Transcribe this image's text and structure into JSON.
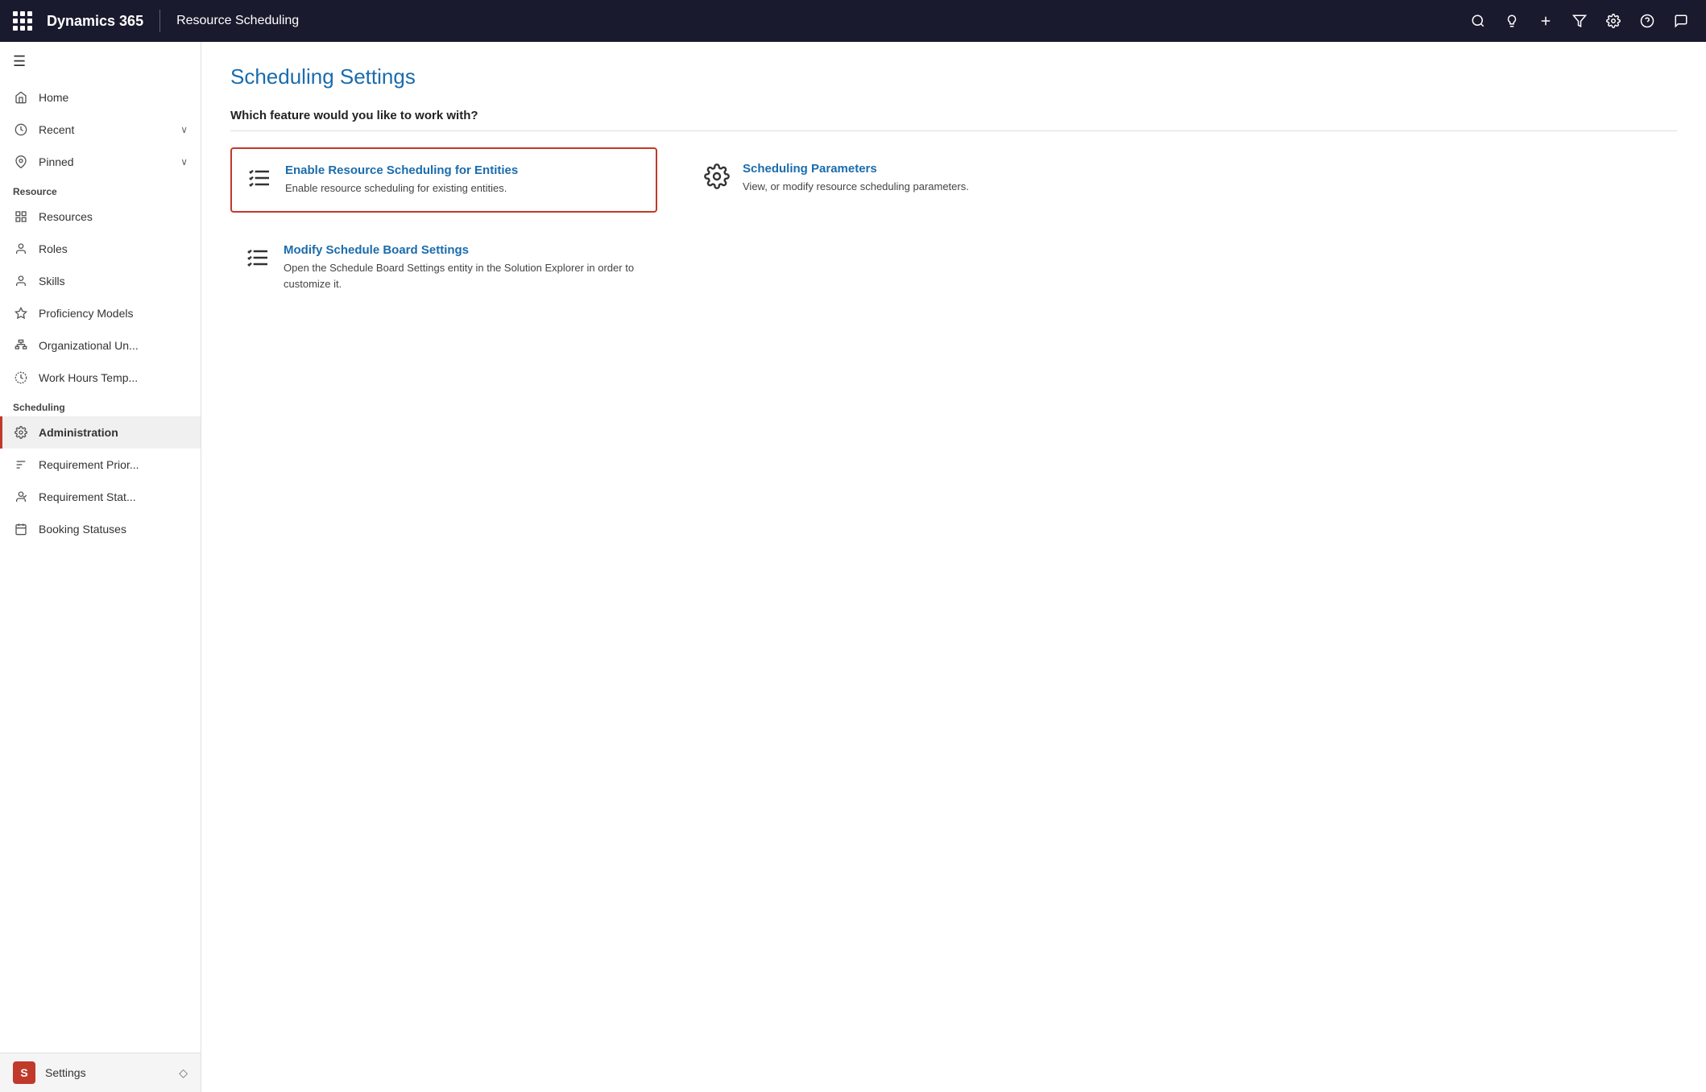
{
  "topnav": {
    "brand": "Dynamics 365",
    "module": "Resource Scheduling",
    "icons": [
      "search",
      "lightbulb",
      "plus",
      "filter",
      "settings",
      "help",
      "chat"
    ]
  },
  "sidebar": {
    "menu_toggle": "≡",
    "nav_sections": [
      {
        "items": [
          {
            "id": "home",
            "label": "Home",
            "icon": "home",
            "has_chevron": false
          },
          {
            "id": "recent",
            "label": "Recent",
            "icon": "clock",
            "has_chevron": true
          },
          {
            "id": "pinned",
            "label": "Pinned",
            "icon": "pin",
            "has_chevron": true
          }
        ]
      },
      {
        "section_label": "Resource",
        "items": [
          {
            "id": "resources",
            "label": "Resources",
            "icon": "resource"
          },
          {
            "id": "roles",
            "label": "Roles",
            "icon": "role"
          },
          {
            "id": "skills",
            "label": "Skills",
            "icon": "skill"
          },
          {
            "id": "proficiency",
            "label": "Proficiency Models",
            "icon": "star"
          },
          {
            "id": "orgunit",
            "label": "Organizational Un...",
            "icon": "org"
          },
          {
            "id": "workhours",
            "label": "Work Hours Temp...",
            "icon": "clock2"
          }
        ]
      },
      {
        "section_label": "Scheduling",
        "items": [
          {
            "id": "administration",
            "label": "Administration",
            "icon": "gear",
            "active": true
          },
          {
            "id": "reqpriority",
            "label": "Requirement Prior...",
            "icon": "priority"
          },
          {
            "id": "reqstatus",
            "label": "Requirement Stat...",
            "icon": "reqstatus"
          },
          {
            "id": "bookingstatus",
            "label": "Booking Statuses",
            "icon": "booking"
          }
        ]
      }
    ],
    "footer": {
      "badge": "S",
      "label": "Settings",
      "chevron": "◇"
    }
  },
  "main": {
    "page_title": "Scheduling Settings",
    "section_question": "Which feature would you like to work with?",
    "cards": [
      {
        "id": "enable-resource-scheduling",
        "title": "Enable Resource Scheduling for Entities",
        "description": "Enable resource scheduling for existing entities.",
        "icon": "checklist",
        "highlighted": true
      },
      {
        "id": "scheduling-parameters",
        "title": "Scheduling Parameters",
        "description": "View, or modify resource scheduling parameters.",
        "icon": "gear",
        "highlighted": false
      },
      {
        "id": "modify-schedule-board",
        "title": "Modify Schedule Board Settings",
        "description": "Open the Schedule Board Settings entity in the Solution Explorer in order to customize it.",
        "icon": "checklist",
        "highlighted": false
      }
    ]
  }
}
